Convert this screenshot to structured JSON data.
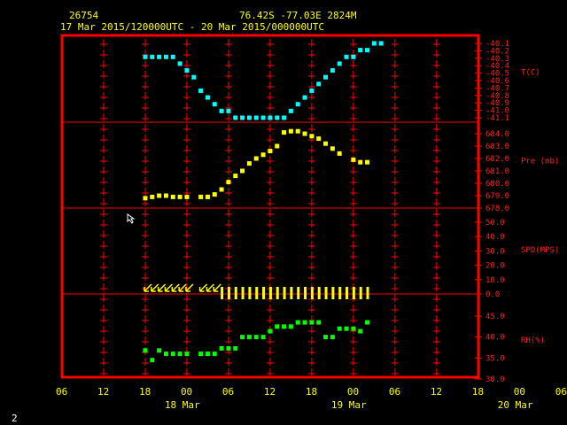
{
  "header": {
    "station_id": "26754",
    "location": "76.42S   -77.03E   2824M",
    "time_range": "17 Mar 2015/120000UTC - 20 Mar 2015/000000UTC"
  },
  "footer": {
    "page_number": "2"
  },
  "colors": {
    "background": "#000000",
    "frame": "#ff0000",
    "temperature": "#00ffff",
    "pressure": "#ffff00",
    "wind": "#ffff00",
    "humidity": "#00ff00",
    "labels": "#ffff00",
    "axis_labels": "#ff2020"
  },
  "chart_data": [
    {
      "type": "scatter",
      "name": "temperature",
      "ylabel": "T(C)",
      "ticks": [
        "-40.1",
        "-40.2",
        "-40.3",
        "-40.4",
        "-40.5",
        "-40.6",
        "-40.7",
        "-40.8",
        "-40.9",
        "-41.0",
        "-41.1"
      ],
      "ylim": [
        -41.1,
        -40.0
      ],
      "x": [
        12,
        13,
        14,
        15,
        16,
        17,
        18,
        19,
        20,
        21,
        22,
        23,
        24,
        25,
        26,
        27,
        28,
        29,
        30,
        31,
        32,
        33,
        34,
        35,
        36,
        37,
        38,
        39,
        40,
        41,
        42,
        43,
        44,
        45,
        46
      ],
      "y": [
        -40.2,
        -40.2,
        -40.2,
        -40.2,
        -40.2,
        -40.3,
        -40.4,
        -40.5,
        -40.7,
        -40.8,
        -40.9,
        -41.0,
        -41.0,
        -41.1,
        -41.1,
        -41.1,
        -41.1,
        -41.1,
        -41.1,
        -41.1,
        -41.1,
        -41.0,
        -40.9,
        -40.8,
        -40.7,
        -40.6,
        -40.5,
        -40.4,
        -40.3,
        -40.2,
        -40.2,
        -40.1,
        -40.1,
        -40.0,
        -40.0
      ]
    },
    {
      "type": "scatter",
      "name": "pressure",
      "ylabel": "Pre (mb)",
      "ticks": [
        "684.0",
        "683.0",
        "682.0",
        "681.0",
        "680.0",
        "679.0",
        "678.0"
      ],
      "ylim": [
        678.0,
        684.0
      ],
      "x": [
        12,
        13,
        14,
        15,
        16,
        17,
        18,
        20,
        21,
        22,
        23,
        24,
        25,
        26,
        27,
        28,
        29,
        30,
        31,
        32,
        33,
        34,
        35,
        36,
        37,
        38,
        39,
        40,
        42,
        43,
        44
      ],
      "y": [
        678.8,
        678.9,
        679.0,
        679.0,
        678.9,
        678.9,
        678.9,
        678.9,
        678.9,
        679.1,
        679.5,
        680.1,
        680.6,
        681.0,
        681.6,
        682.0,
        682.3,
        682.6,
        683.0,
        684.1,
        684.2,
        684.2,
        684.0,
        683.8,
        683.6,
        683.2,
        682.8,
        682.4,
        681.9,
        681.7,
        681.7
      ]
    },
    {
      "type": "barbs",
      "name": "wind",
      "ylabel": "SPD(MPS)",
      "ticks": [
        "50.0",
        "40.0",
        "30.0",
        "20.0",
        "10.0",
        "0.0"
      ],
      "ylim": [
        0.0,
        50.0
      ],
      "x": [
        12,
        13,
        14,
        15,
        16,
        17,
        18,
        20,
        21,
        22,
        23,
        24,
        25,
        26,
        27,
        28,
        29,
        30,
        31,
        32,
        33,
        34,
        35,
        36,
        37,
        38,
        39,
        40,
        41,
        42,
        43,
        44
      ],
      "y": [
        4.0,
        4.0,
        4.0,
        4.0,
        4.0,
        4.0,
        4.0,
        4.0,
        4.0,
        4.0,
        0.0,
        0.0,
        0.0,
        0.0,
        0.0,
        0.0,
        0.0,
        0.0,
        0.0,
        0.0,
        0.0,
        0.0,
        0.0,
        0.0,
        0.0,
        0.0,
        0.0,
        0.0,
        0.0,
        0.0,
        0.0,
        0.0
      ]
    },
    {
      "type": "scatter",
      "name": "humidity",
      "ylabel": "RH(%)",
      "ticks": [
        "45.0",
        "40.0",
        "35.0",
        "30.0"
      ],
      "ylim": [
        30.0,
        45.0
      ],
      "x": [
        12,
        13,
        14,
        15,
        16,
        17,
        18,
        20,
        21,
        22,
        23,
        24,
        25,
        26,
        27,
        28,
        29,
        30,
        31,
        32,
        33,
        34,
        35,
        36,
        37,
        38,
        39,
        40,
        41,
        42,
        43,
        44
      ],
      "y": [
        36.8,
        34.5,
        36.8,
        36.0,
        36.0,
        36.0,
        36.0,
        36.0,
        36.0,
        36.0,
        37.3,
        37.3,
        37.3,
        40.0,
        40.0,
        40.0,
        40.0,
        41.4,
        42.5,
        42.5,
        42.5,
        43.5,
        43.5,
        43.5,
        43.5,
        40.0,
        40.0,
        42.0,
        42.0,
        42.0,
        41.4,
        43.5
      ]
    }
  ],
  "x_axis": {
    "hour_labels": [
      "06",
      "12",
      "18",
      "00",
      "06",
      "12",
      "18",
      "00",
      "06",
      "12",
      "18",
      "00",
      "06"
    ],
    "date_labels": [
      "18 Mar",
      "19 Mar",
      "20 Mar"
    ]
  }
}
